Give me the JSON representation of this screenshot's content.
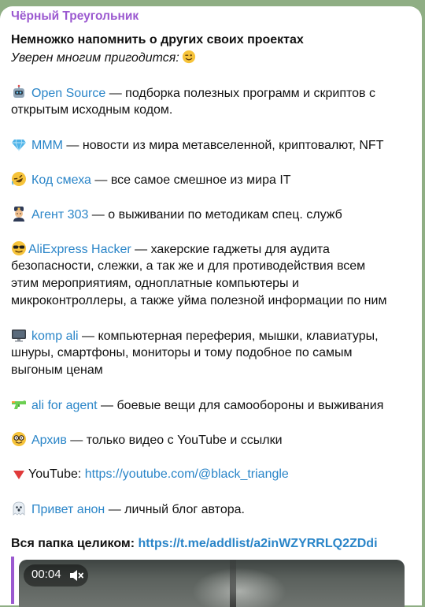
{
  "post": {
    "author": "Чёрный Треугольник",
    "title": "Немножко напомнить о других своих проектах",
    "subtitle": "Уверен многим пригодится:",
    "items": [
      {
        "emoji": "robot-icon",
        "link": "Open Source",
        "text_lines": [
          " — подборка полезных программ и скриптов с",
          "открытым исходным кодом."
        ]
      },
      {
        "emoji": "gem-icon",
        "link": "МММ",
        "text_lines": [
          " —  новости из мира метавселенной, криптовалют, NFT"
        ]
      },
      {
        "emoji": "rofl-face-icon",
        "link": "Код смеха",
        "text_lines": [
          " — все самое смешное из мира IT"
        ]
      },
      {
        "emoji": "police-officer-icon",
        "link": "Агент 303",
        "text_lines": [
          " — о выживании по методикам спец. служб"
        ]
      },
      {
        "emoji": "sunglasses-face-icon",
        "link": "AliExpress Hacker",
        "text_lines": [
          " — хакерские гаджеты для аудита",
          "безопасности, слежки, а так же и для противодействия всем",
          "этим мероприятиям, одноплатные компьютеры и",
          "микроконтроллеры, а также уйма полезной информации по ним"
        ]
      },
      {
        "emoji": "desktop-computer-icon",
        "link": "komp ali",
        "text_lines": [
          " — компьютерная переферия, мышки, клавиатуры,",
          "шнуры, смартфоны, мониторы и тому подобное по самым",
          "выгоным ценам"
        ]
      },
      {
        "emoji": "water-pistol-icon",
        "link": "ali for agent",
        "text_lines": [
          " — боевые вещи для самообороны и выживания"
        ]
      },
      {
        "emoji": "nerd-face-icon",
        "link": "Архив",
        "text_lines": [
          " — только видео с YouTube и ссылки"
        ]
      },
      {
        "emoji": "red-triangle-icon",
        "prefix": "YouTube: ",
        "link": "https://youtube.com/@black_triangle",
        "text_lines": [
          ""
        ]
      },
      {
        "emoji": "ghost-icon",
        "link": "Привет анон",
        "text_lines": [
          " — личный блог автора."
        ]
      }
    ],
    "folder_label": "Вся папка целиком: ",
    "folder_link": "https://t.me/addlist/a2inWZYRRLQ2ZDdi"
  },
  "video": {
    "time": "00:04",
    "muted": true
  },
  "colors": {
    "accent": "#9b59d0",
    "link": "#2a85c8",
    "background": "#8fae84"
  }
}
